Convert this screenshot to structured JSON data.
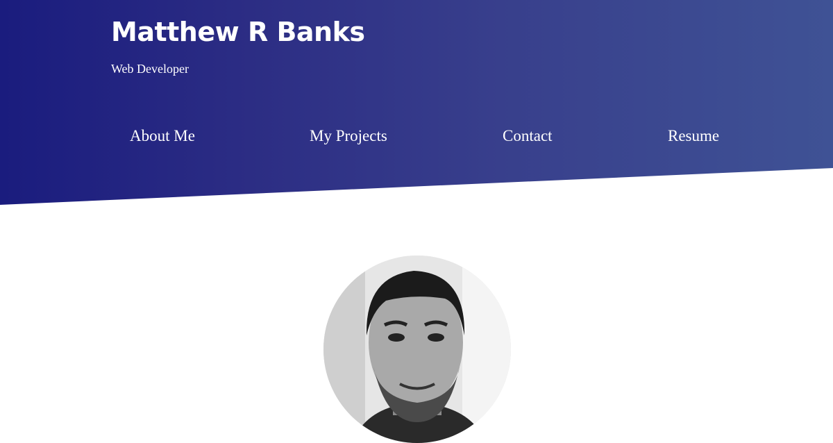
{
  "header": {
    "name": "Matthew R Banks",
    "subtitle": "Web Developer"
  },
  "nav": [
    {
      "label": "About Me"
    },
    {
      "label": "My Projects"
    },
    {
      "label": "Contact"
    },
    {
      "label": "Resume"
    }
  ],
  "colors": {
    "gradient_start": "#1a1c7e",
    "gradient_end": "#3f5295"
  },
  "profile": {
    "image": "profile-photo"
  }
}
